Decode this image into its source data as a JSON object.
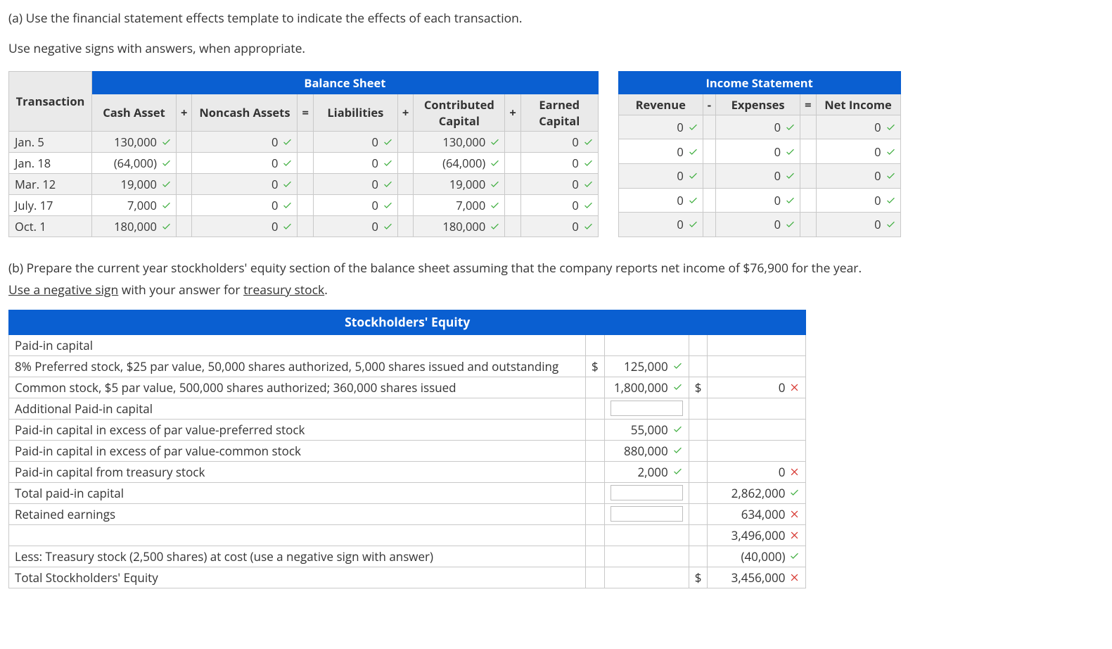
{
  "partA": {
    "instruction": "(a) Use the financial statement effects template to indicate the effects of each transaction.",
    "sub": "Use negative signs with answers, when appropriate.",
    "balance_title": "Balance Sheet",
    "income_title": "Income Statement",
    "headers": {
      "transaction": "Transaction",
      "cash": "Cash Asset",
      "noncash": "Noncash Assets",
      "liab": "Liabilities",
      "contrib": "Contributed Capital",
      "earned": "Earned Capital",
      "rev": "Revenue",
      "exp": "Expenses",
      "net": "Net Income"
    },
    "ops": {
      "plus": "+",
      "eq": "=",
      "minus": "-"
    },
    "rows": [
      {
        "date": "Jan. 5",
        "cash": "130,000",
        "noncash": "0",
        "liab": "0",
        "contrib": "130,000",
        "earned": "0",
        "rev": "0",
        "exp": "0",
        "net": "0"
      },
      {
        "date": "Jan. 18",
        "cash": "(64,000)",
        "noncash": "0",
        "liab": "0",
        "contrib": "(64,000)",
        "earned": "0",
        "rev": "0",
        "exp": "0",
        "net": "0"
      },
      {
        "date": "Mar. 12",
        "cash": "19,000",
        "noncash": "0",
        "liab": "0",
        "contrib": "19,000",
        "earned": "0",
        "rev": "0",
        "exp": "0",
        "net": "0"
      },
      {
        "date": "July. 17",
        "cash": "7,000",
        "noncash": "0",
        "liab": "0",
        "contrib": "7,000",
        "earned": "0",
        "rev": "0",
        "exp": "0",
        "net": "0"
      },
      {
        "date": "Oct. 1",
        "cash": "180,000",
        "noncash": "0",
        "liab": "0",
        "contrib": "180,000",
        "earned": "0",
        "rev": "0",
        "exp": "0",
        "net": "0"
      }
    ]
  },
  "partB": {
    "instruction": "(b) Prepare the current year stockholders' equity section of the balance sheet assuming that the company reports net income of $76,900 for the year.",
    "sub_pre": "Use a negative sign",
    "sub_mid": " with your answer for ",
    "sub_post": "treasury stock",
    "sub_end": ".",
    "title": "Stockholders' Equity",
    "dollar": "$",
    "rows": {
      "r1": "Paid-in capital",
      "r2": "8% Preferred stock, $25 par value, 50,000 shares authorized, 5,000 shares issued and outstanding",
      "r3": "Common stock, $5 par value, 500,000 shares authorized; 360,000 shares issued",
      "r4": "Additional Paid-in capital",
      "r5": "Paid-in capital in excess of par value-preferred stock",
      "r6": "Paid-in capital in excess of par value-common stock",
      "r7": "Paid-in capital from treasury stock",
      "r8": "Total paid-in capital",
      "r9": "Retained earnings",
      "r10": "",
      "r11": "Less: Treasury stock (2,500 shares) at cost (use a negative sign with answer)",
      "r12": "Total Stockholders' Equity"
    },
    "vals": {
      "v2a": "125,000",
      "v3a": "1,800,000",
      "v3b": "0",
      "v5a": "55,000",
      "v6a": "880,000",
      "v7a": "2,000",
      "v7b": "0",
      "v8b": "2,862,000",
      "v9b": "634,000",
      "v10b": "3,496,000",
      "v11b": "(40,000)",
      "v12b": "3,456,000"
    },
    "marks": {
      "v2a": "check",
      "v3a": "check",
      "v3b": "x",
      "v5a": "check",
      "v6a": "check",
      "v7a": "check",
      "v7b": "x",
      "v8b": "check",
      "v9b": "x",
      "v10b": "x",
      "v11b": "check",
      "v12b": "x"
    }
  }
}
